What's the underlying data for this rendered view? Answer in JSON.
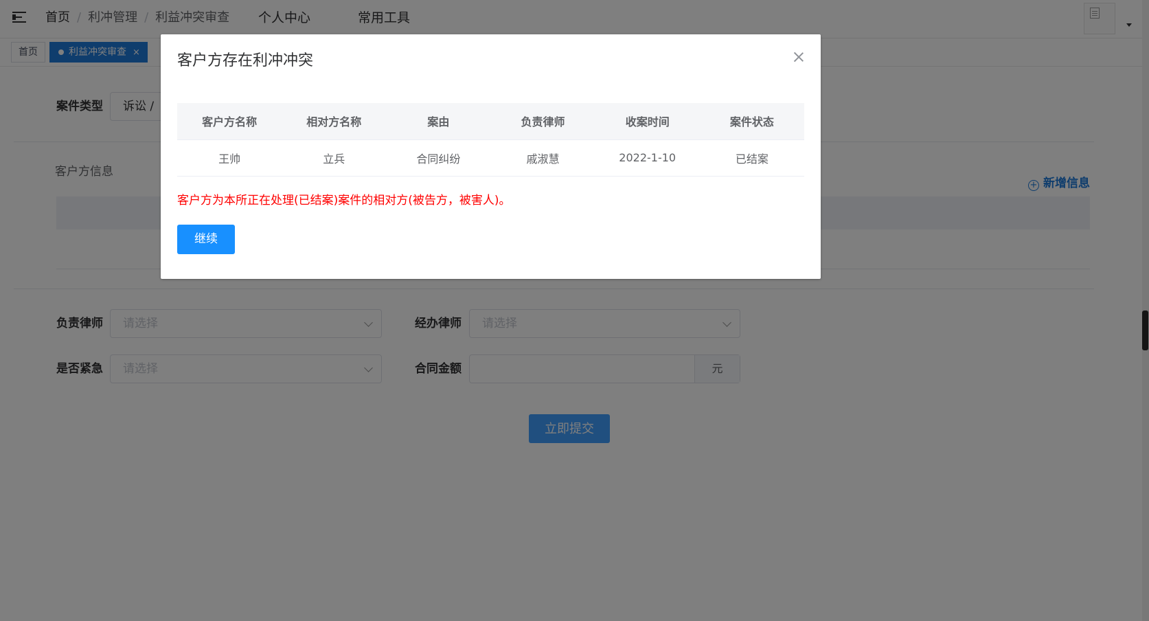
{
  "header": {
    "breadcrumb": [
      "首页",
      "利冲管理",
      "利益冲突审查"
    ],
    "nav": [
      "个人中心",
      "常用工具"
    ]
  },
  "tags": {
    "home": "首页",
    "active": "利益冲突审查",
    "close": "×"
  },
  "form": {
    "case_type_label": "案件类型",
    "case_type_value": "诉讼 /",
    "client_section_title": "客户方信息",
    "add_info_label": "新增信息",
    "add_info_plus": "+",
    "lead_lawyer_label": "负责律师",
    "lead_lawyer_placeholder": "请选择",
    "handling_lawyer_label": "经办律师",
    "handling_lawyer_placeholder": "请选择",
    "urgent_label": "是否紧急",
    "urgent_placeholder": "请选择",
    "amount_label": "合同金额",
    "amount_suffix": "元",
    "submit_label": "立即提交"
  },
  "dialog": {
    "title": "客户方存在利冲冲突",
    "columns": [
      "客户方名称",
      "相对方名称",
      "案由",
      "负责律师",
      "收案时间",
      "案件状态"
    ],
    "rows": [
      [
        "王帅",
        "立兵",
        "合同纠纷",
        "戚淑慧",
        "2022-1-10",
        "已结案"
      ]
    ],
    "warning": "客户方为本所正在处理(已结案)案件的相对方(被告方，被害人)。",
    "continue_label": "继续"
  }
}
